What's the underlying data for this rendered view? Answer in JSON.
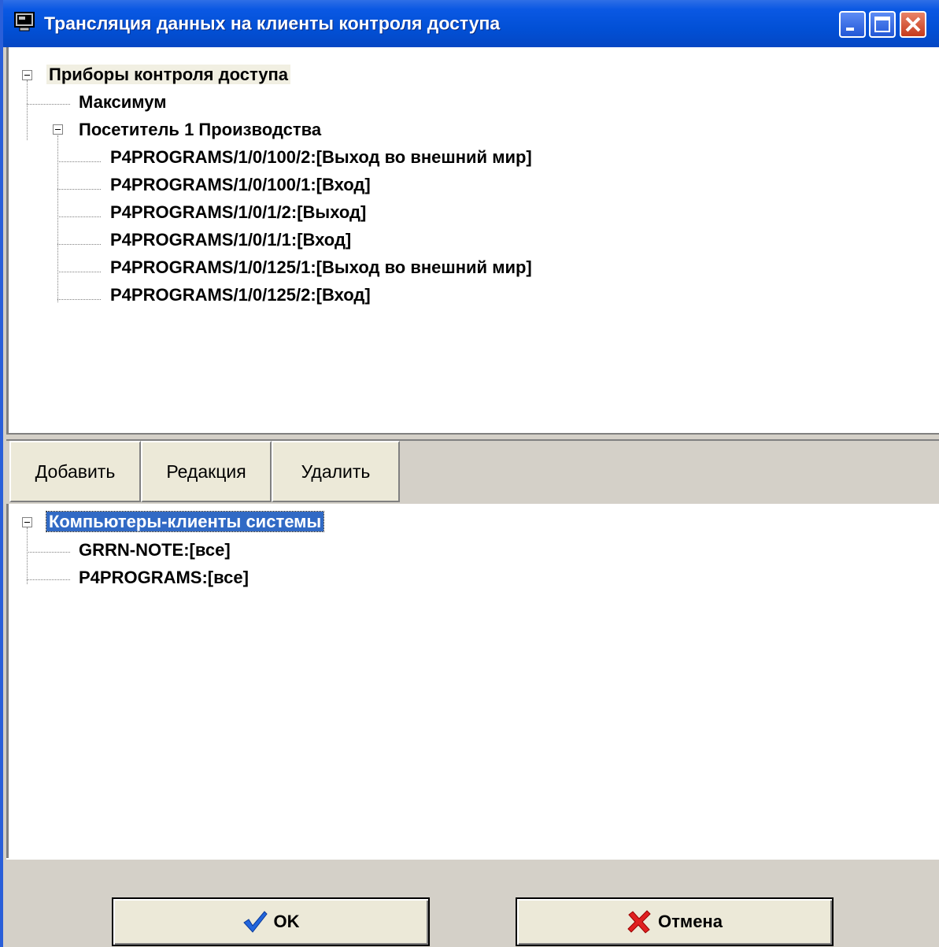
{
  "window": {
    "title": "Трансляция данных на клиенты контроля доступа",
    "icon": "monitor-icon"
  },
  "top_tree": {
    "root": "Приборы контроля доступа",
    "children": [
      {
        "label": "Максимум"
      },
      {
        "label": "Посетитель 1 Производства",
        "children": [
          "P4PROGRAMS/1/0/100/2:[Выход во внешний мир]",
          "P4PROGRAMS/1/0/100/1:[Вход]",
          "P4PROGRAMS/1/0/1/2:[Выход]",
          "P4PROGRAMS/1/0/1/1:[Вход]",
          "P4PROGRAMS/1/0/125/1:[Выход во внешний мир]",
          "P4PROGRAMS/1/0/125/2:[Вход]"
        ]
      }
    ]
  },
  "toolbar": {
    "add_label": "Добавить",
    "edit_label": "Редакция",
    "delete_label": "Удалить"
  },
  "bottom_tree": {
    "root": "Компьютеры-клиенты системы",
    "children": [
      "GRRN-NOTE:[все]",
      "P4PROGRAMS:[все]"
    ]
  },
  "footer": {
    "ok_label": "OK",
    "cancel_label": "Отмена",
    "ok_icon": "checkmark-icon",
    "cancel_icon": "cross-icon"
  },
  "colors": {
    "titlebar": "#0250d6",
    "selection": "#316ac5",
    "face": "#d4d0c8"
  }
}
